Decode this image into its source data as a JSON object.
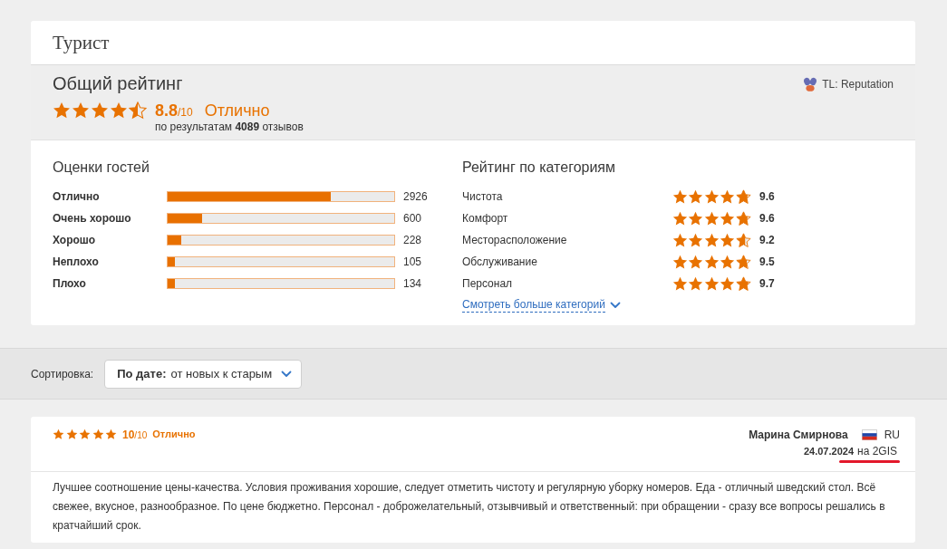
{
  "page": {
    "title": "Турист"
  },
  "overall": {
    "heading": "Общий рейтинг",
    "stars": 4.5,
    "score": "8.8",
    "scale": "/10",
    "verdict": "Отлично",
    "summary": "по результатам **4089** отзывов",
    "provider": "TL: Reputation"
  },
  "guest_ratings": {
    "heading": "Оценки гостей",
    "rows": [
      {
        "label": "Отлично",
        "level": 0.72,
        "count": "2926"
      },
      {
        "label": "Очень хорошо",
        "level": 0.15,
        "count": "600"
      },
      {
        "label": "Хорошо",
        "level": 0.06,
        "count": "228"
      },
      {
        "label": "Неплохо",
        "level": 0.03,
        "count": "105"
      },
      {
        "label": "Плохо",
        "level": 0.03,
        "count": "134"
      }
    ]
  },
  "categories": {
    "heading": "Рейтинг по категориям",
    "rows": [
      {
        "label": "Чистота",
        "stars": 4.75,
        "score": "9.6"
      },
      {
        "label": "Комфорт",
        "stars": 4.75,
        "score": "9.6"
      },
      {
        "label": "Месторасположение",
        "stars": 4.6,
        "score": "9.2"
      },
      {
        "label": "Обслуживание",
        "stars": 4.7,
        "score": "9.5"
      },
      {
        "label": "Персонал",
        "stars": 4.8,
        "score": "9.7"
      }
    ],
    "more_link": "Смотреть больше категорий"
  },
  "sort": {
    "label": "Сортировка:",
    "field": "По дате:",
    "value": "от новых к старым"
  },
  "reviews": [
    {
      "stars": 5,
      "score": "10",
      "scale": "/10",
      "verdict": "Отлично",
      "author": "Марина Смирнова",
      "country": "RU",
      "date": "24.07.2024",
      "source": "на 2GIS",
      "source_marked": true,
      "text": "Лучшее соотношение цены-качества. Условия проживания хорошие, следует отметить чистоту и регулярную уборку номеров. Еда - отличный шведский стол. Всё свежее, вкусное, разнообразное. По цене бюджетно. Персонал - доброжелательный, отзывчивый и ответственный: при обращении - сразу все вопросы решались в кратчайший срок."
    }
  ]
}
